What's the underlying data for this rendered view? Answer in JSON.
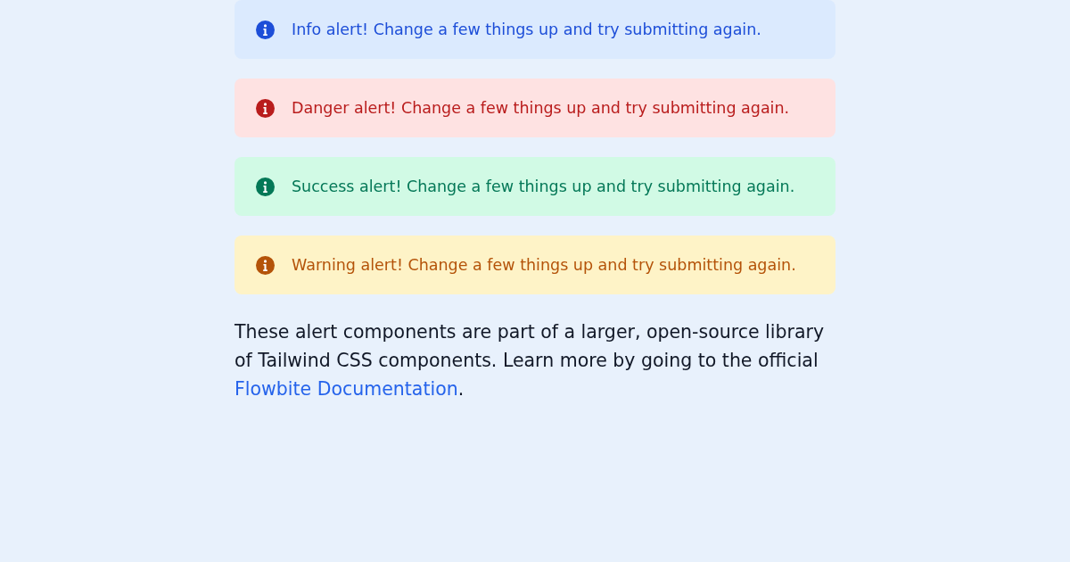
{
  "alerts": [
    {
      "kind": "info",
      "text": "Info alert! Change a few things up and try submitting again."
    },
    {
      "kind": "danger",
      "text": "Danger alert! Change a few things up and try submitting again."
    },
    {
      "kind": "success",
      "text": "Success alert! Change a few things up and try submitting again."
    },
    {
      "kind": "warning",
      "text": "Warning alert! Change a few things up and try submitting again."
    }
  ],
  "note": {
    "text": "These alert components are part of a larger, open-source library of Tailwind CSS components. Learn more by going to the official ",
    "link": "Flowbite Documentation",
    "after": "."
  }
}
